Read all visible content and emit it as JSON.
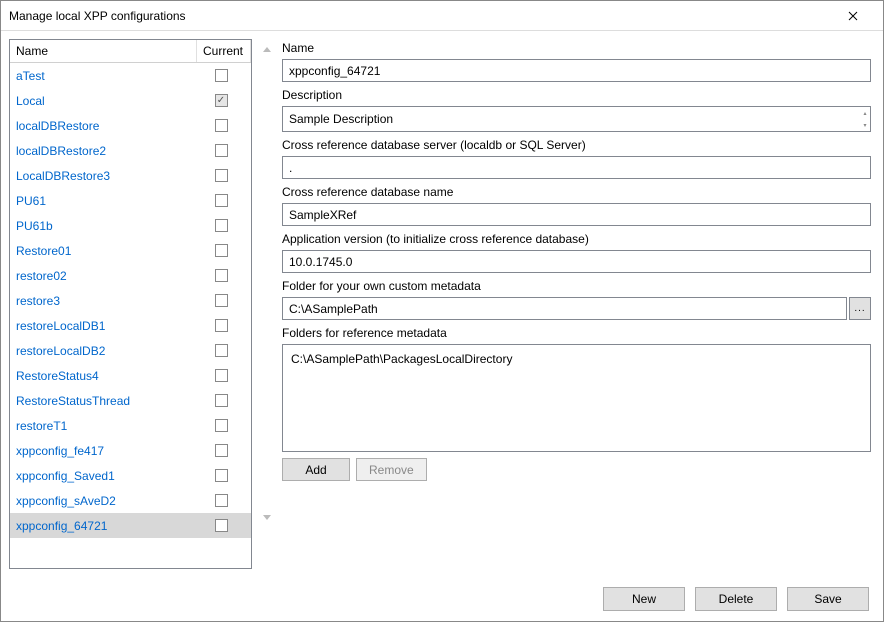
{
  "window": {
    "title": "Manage local XPP configurations"
  },
  "table": {
    "headers": {
      "name": "Name",
      "current": "Current"
    },
    "rows": [
      {
        "name": "aTest",
        "current": false,
        "selected": false
      },
      {
        "name": "Local",
        "current": true,
        "selected": false
      },
      {
        "name": "localDBRestore",
        "current": false,
        "selected": false
      },
      {
        "name": "localDBRestore2",
        "current": false,
        "selected": false
      },
      {
        "name": "LocalDBRestore3",
        "current": false,
        "selected": false
      },
      {
        "name": "PU61",
        "current": false,
        "selected": false
      },
      {
        "name": "PU61b",
        "current": false,
        "selected": false
      },
      {
        "name": "Restore01",
        "current": false,
        "selected": false
      },
      {
        "name": "restore02",
        "current": false,
        "selected": false
      },
      {
        "name": "restore3",
        "current": false,
        "selected": false
      },
      {
        "name": "restoreLocalDB1",
        "current": false,
        "selected": false
      },
      {
        "name": "restoreLocalDB2",
        "current": false,
        "selected": false
      },
      {
        "name": "RestoreStatus4",
        "current": false,
        "selected": false
      },
      {
        "name": "RestoreStatusThread",
        "current": false,
        "selected": false
      },
      {
        "name": "restoreT1",
        "current": false,
        "selected": false
      },
      {
        "name": "xppconfig_fe417",
        "current": false,
        "selected": false
      },
      {
        "name": "xppconfig_Saved1",
        "current": false,
        "selected": false
      },
      {
        "name": "xppconfig_sAveD2",
        "current": false,
        "selected": false
      },
      {
        "name": "xppconfig_64721",
        "current": false,
        "selected": true
      }
    ]
  },
  "form": {
    "name": {
      "label": "Name",
      "value": "xppconfig_64721"
    },
    "description": {
      "label": "Description",
      "value": "Sample Description"
    },
    "xrefServer": {
      "label": "Cross reference database server (localdb or SQL Server)",
      "value": "."
    },
    "xrefDb": {
      "label": "Cross reference database name",
      "value": "SampleXRef"
    },
    "appVersion": {
      "label": "Application version (to initialize cross reference database)",
      "value": "10.0.1745.0"
    },
    "customMeta": {
      "label": "Folder for your own custom metadata",
      "value": "C:\\ASamplePath"
    },
    "refMeta": {
      "label": "Folders for reference metadata",
      "items": [
        "C:\\ASamplePath\\PackagesLocalDirectory"
      ]
    }
  },
  "buttons": {
    "browse": "...",
    "add": "Add",
    "remove": "Remove",
    "new": "New",
    "delete": "Delete",
    "save": "Save"
  }
}
